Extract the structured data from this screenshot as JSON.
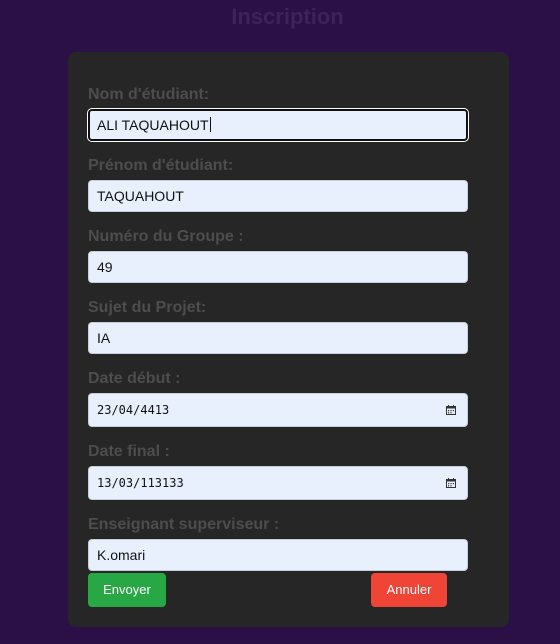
{
  "page": {
    "title": "Inscription"
  },
  "form": {
    "fields": [
      {
        "label": "Nom d'étudiant:",
        "value": "ALI TAQUAHOUT"
      },
      {
        "label": "Prénom d'étudiant:",
        "value": "TAQUAHOUT"
      },
      {
        "label": "Numéro du Groupe :",
        "value": "49"
      },
      {
        "label": "Sujet du Projet:",
        "value": "IA"
      },
      {
        "label": "Date début :",
        "value": "23/04/4413"
      },
      {
        "label": "Date final :",
        "value": "13/03/113133"
      },
      {
        "label": "Enseignant superviseur :",
        "value": "K.omari"
      }
    ],
    "submit_label": "Envoyer",
    "cancel_label": "Annuler"
  },
  "icons": {
    "date_start": "calendar-icon",
    "date_end": "calendar-icon"
  },
  "colors": {
    "background": "#2b0f47",
    "card": "#262626",
    "submit": "#28a745",
    "cancel": "#f04437"
  }
}
